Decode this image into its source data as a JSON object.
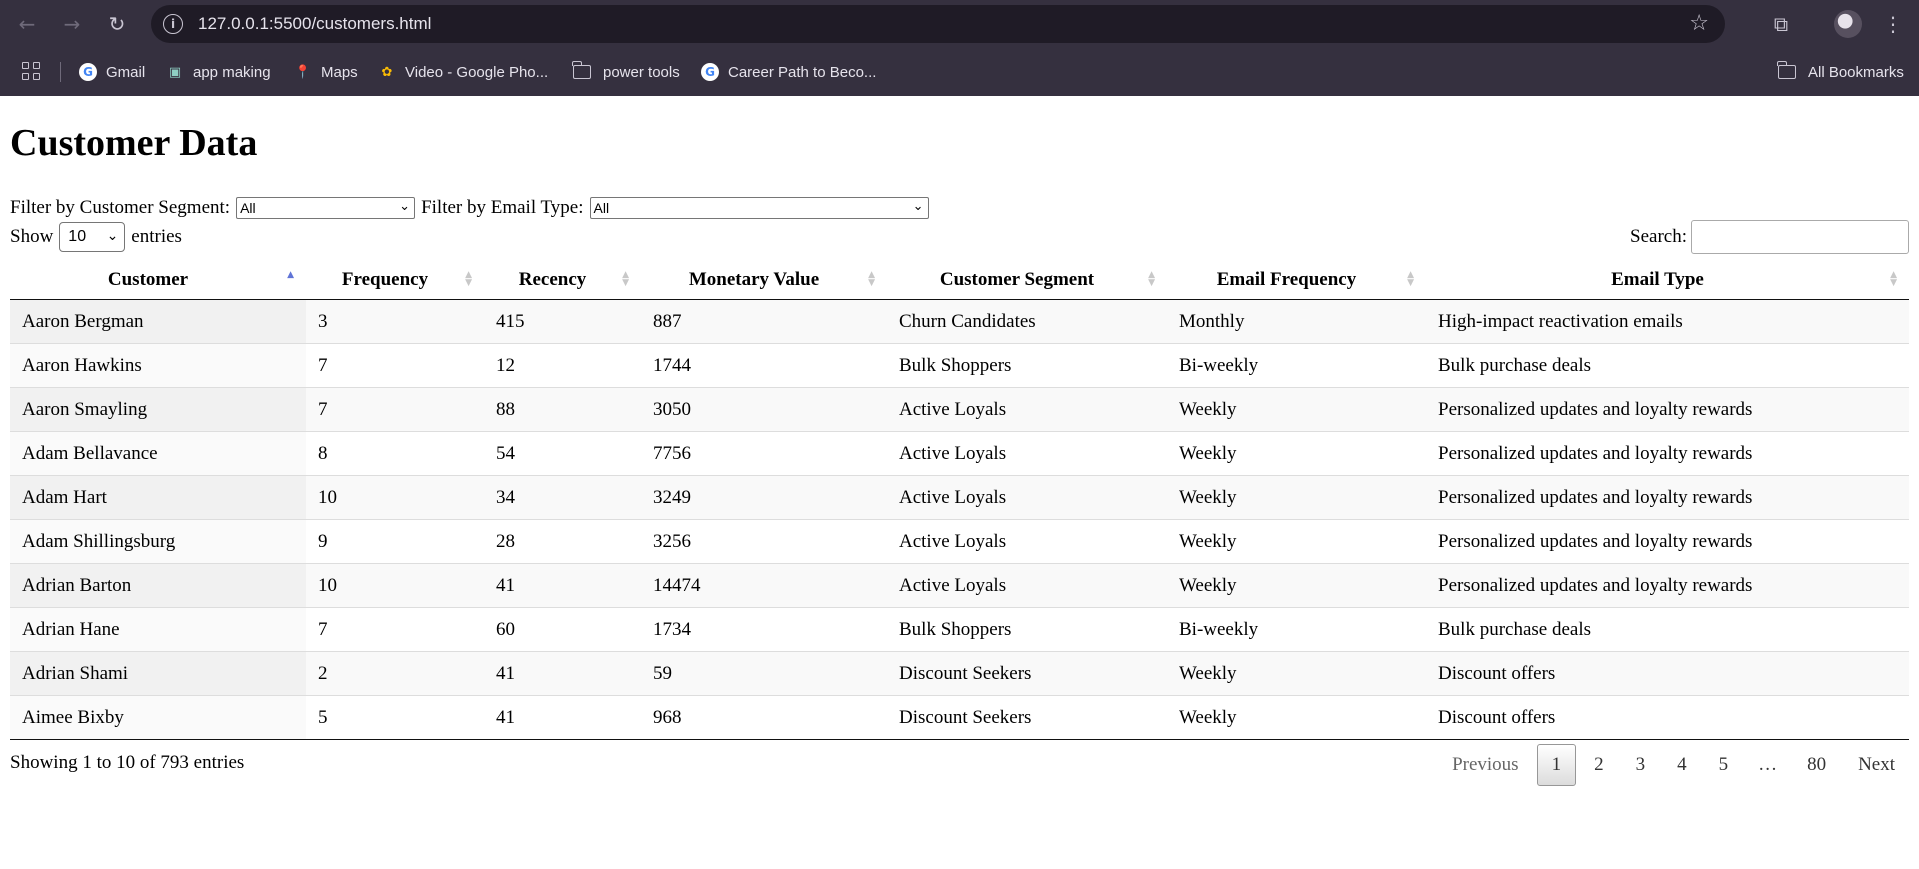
{
  "browser": {
    "url": "127.0.0.1:5500/customers.html",
    "bookmarks": [
      {
        "label": "Gmail",
        "icon": "google-icon"
      },
      {
        "label": "app making",
        "icon": "display-icon"
      },
      {
        "label": "Maps",
        "icon": "maps-pin-icon"
      },
      {
        "label": "Video - Google Pho...",
        "icon": "google-photos-icon"
      },
      {
        "label": "power tools",
        "icon": "folder-icon"
      },
      {
        "label": "Career Path to Beco...",
        "icon": "google-icon"
      }
    ],
    "all_bookmarks_label": "All Bookmarks"
  },
  "page": {
    "title": "Customer Data",
    "filters": {
      "segment_label": "Filter by Customer Segment:",
      "segment_value": "All",
      "email_label": "Filter by Email Type:",
      "email_value": "All"
    },
    "length": {
      "show_label": "Show",
      "value": "10",
      "entries_label": "entries"
    },
    "search": {
      "label": "Search:",
      "value": ""
    }
  },
  "table": {
    "columns": [
      "Customer",
      "Frequency",
      "Recency",
      "Monetary Value",
      "Customer Segment",
      "Email Frequency",
      "Email Type"
    ],
    "sorted_column": "Customer",
    "sort_direction": "ascending",
    "rows": [
      [
        "Aaron Bergman",
        "3",
        "415",
        "887",
        "Churn Candidates",
        "Monthly",
        "High-impact reactivation emails"
      ],
      [
        "Aaron Hawkins",
        "7",
        "12",
        "1744",
        "Bulk Shoppers",
        "Bi-weekly",
        "Bulk purchase deals"
      ],
      [
        "Aaron Smayling",
        "7",
        "88",
        "3050",
        "Active Loyals",
        "Weekly",
        "Personalized updates and loyalty rewards"
      ],
      [
        "Adam Bellavance",
        "8",
        "54",
        "7756",
        "Active Loyals",
        "Weekly",
        "Personalized updates and loyalty rewards"
      ],
      [
        "Adam Hart",
        "10",
        "34",
        "3249",
        "Active Loyals",
        "Weekly",
        "Personalized updates and loyalty rewards"
      ],
      [
        "Adam Shillingsburg",
        "9",
        "28",
        "3256",
        "Active Loyals",
        "Weekly",
        "Personalized updates and loyalty rewards"
      ],
      [
        "Adrian Barton",
        "10",
        "41",
        "14474",
        "Active Loyals",
        "Weekly",
        "Personalized updates and loyalty rewards"
      ],
      [
        "Adrian Hane",
        "7",
        "60",
        "1734",
        "Bulk Shoppers",
        "Bi-weekly",
        "Bulk purchase deals"
      ],
      [
        "Adrian Shami",
        "2",
        "41",
        "59",
        "Discount Seekers",
        "Weekly",
        "Discount offers"
      ],
      [
        "Aimee Bixby",
        "5",
        "41",
        "968",
        "Discount Seekers",
        "Weekly",
        "Discount offers"
      ]
    ]
  },
  "footer": {
    "info": "Showing 1 to 10 of 793 entries",
    "pagination": {
      "previous": "Previous",
      "pages": [
        "1",
        "2",
        "3",
        "4",
        "5",
        "…",
        "80"
      ],
      "current": "1",
      "next": "Next"
    }
  }
}
